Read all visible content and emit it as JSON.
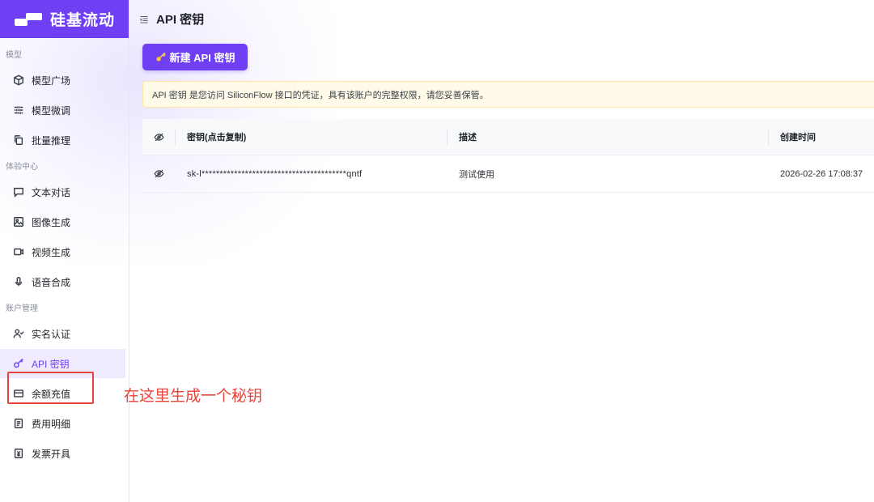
{
  "brand": {
    "name": "硅基流动",
    "color": "#6e3ff3"
  },
  "sidebar": {
    "groups": [
      {
        "label": "模型",
        "items": [
          {
            "label": "模型广场",
            "icon": "cube-icon"
          },
          {
            "label": "模型微调",
            "icon": "sliders-icon"
          },
          {
            "label": "批量推理",
            "icon": "copy-icon"
          }
        ]
      },
      {
        "label": "体验中心",
        "items": [
          {
            "label": "文本对话",
            "icon": "chat-icon"
          },
          {
            "label": "图像生成",
            "icon": "image-icon"
          },
          {
            "label": "视频生成",
            "icon": "video-icon"
          },
          {
            "label": "语音合成",
            "icon": "mic-icon"
          }
        ]
      },
      {
        "label": "账户管理",
        "items": [
          {
            "label": "实名认证",
            "icon": "user-check-icon"
          },
          {
            "label": "API 密钥",
            "icon": "key-icon",
            "active": true
          },
          {
            "label": "余额充值",
            "icon": "card-icon"
          },
          {
            "label": "费用明细",
            "icon": "receipt-icon"
          },
          {
            "label": "发票开具",
            "icon": "invoice-icon"
          }
        ]
      }
    ]
  },
  "annotation": {
    "text": "在这里生成一个秘钥",
    "color": "#e5453a"
  },
  "header": {
    "title": "API 密钥"
  },
  "create_button": {
    "label": "新建 API 密钥"
  },
  "notice": {
    "text": "API 密钥 是您访问 SiliconFlow 接口的凭证，具有该账户的完整权限，请您妥善保管。"
  },
  "table": {
    "columns": [
      "密钥(点击复制)",
      "描述",
      "创建时间"
    ],
    "rows": [
      {
        "key": "sk-l****************************************qntf",
        "description": "测试使用",
        "created": "2026-02-26 17:08:37"
      }
    ]
  }
}
